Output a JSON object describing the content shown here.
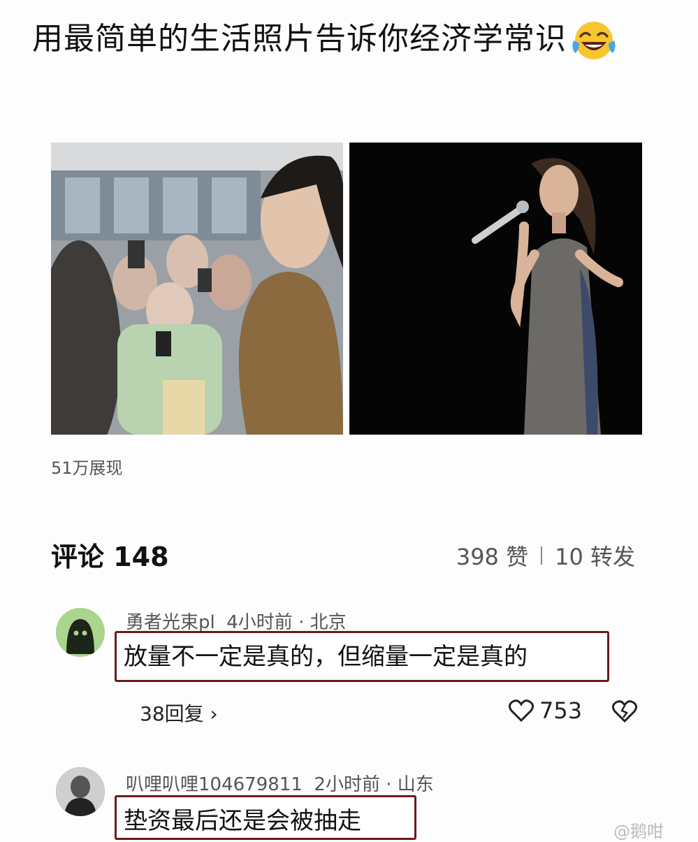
{
  "post": {
    "title": "用最简单的生活照片告诉你经济学常识",
    "emoji_icon": "laughing-with-tears-icon",
    "views": "51万展现"
  },
  "comments_section": {
    "header": "评论 148",
    "likes": "398 赞",
    "shares": "10 转发"
  },
  "comments": [
    {
      "username": "勇者光束pl",
      "time": "4小时前",
      "location": "北京",
      "text": "放量不一定是真的，但缩量一定是真的",
      "replies": "38回复",
      "likes": "753"
    },
    {
      "username": "叭哩叭哩104679811",
      "time": "2小时前",
      "location": "山东",
      "text": "垫资最后还是会被抽走"
    }
  ],
  "watermark": "@鹅咁",
  "colors": {
    "comment_border": "#6b1a1a",
    "avatar_green": "#a9d58f"
  }
}
